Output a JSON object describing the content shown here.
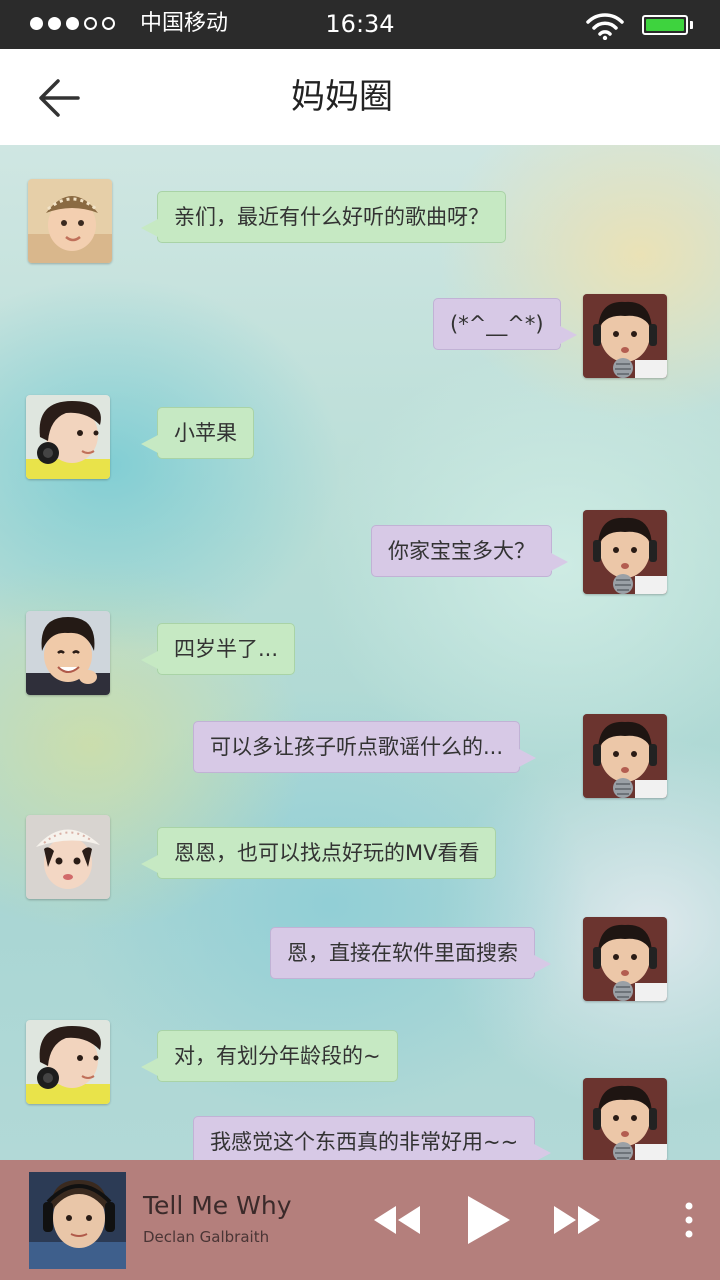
{
  "status_bar": {
    "signal_dots": 5,
    "signal_filled": 3,
    "carrier": "中国移动",
    "time": "16:34",
    "battery_level": 1.0,
    "battery_color": "#3ed33e"
  },
  "header": {
    "title": "妈妈圈"
  },
  "messages": [
    {
      "side": "left",
      "text": "亲们，最近有什么好听的歌曲呀？",
      "avatar": "baby-in-knit-hat"
    },
    {
      "side": "right",
      "text": "(*^__^*)",
      "avatar": "boy-with-microphone"
    },
    {
      "side": "left",
      "text": "小苹果",
      "avatar": "girl-with-headphones"
    },
    {
      "side": "right",
      "text": "你家宝宝多大？",
      "avatar": "boy-with-microphone"
    },
    {
      "side": "left",
      "text": "四岁半了...",
      "avatar": "smiling-boy"
    },
    {
      "side": "right",
      "text": "可以多让孩子听点歌谣什么的...",
      "avatar": "boy-with-microphone"
    },
    {
      "side": "left",
      "text": "恩恩，也可以找点好玩的MV看看",
      "avatar": "girl-in-white-hat"
    },
    {
      "side": "right",
      "text": "恩，直接在软件里面搜索",
      "avatar": "boy-with-microphone"
    },
    {
      "side": "left",
      "text": "对，有划分年龄段的~",
      "avatar": "girl-with-headphones"
    },
    {
      "side": "right",
      "text": "我感觉这个东西真的非常好用~~",
      "avatar": "boy-with-microphone"
    }
  ],
  "player": {
    "title": "Tell Me Why",
    "artist": "Declan  Galbraith",
    "background": "#b47f7c"
  },
  "colors": {
    "left_bubble": "#c6e9c3",
    "right_bubble": "#d7c9e6"
  }
}
